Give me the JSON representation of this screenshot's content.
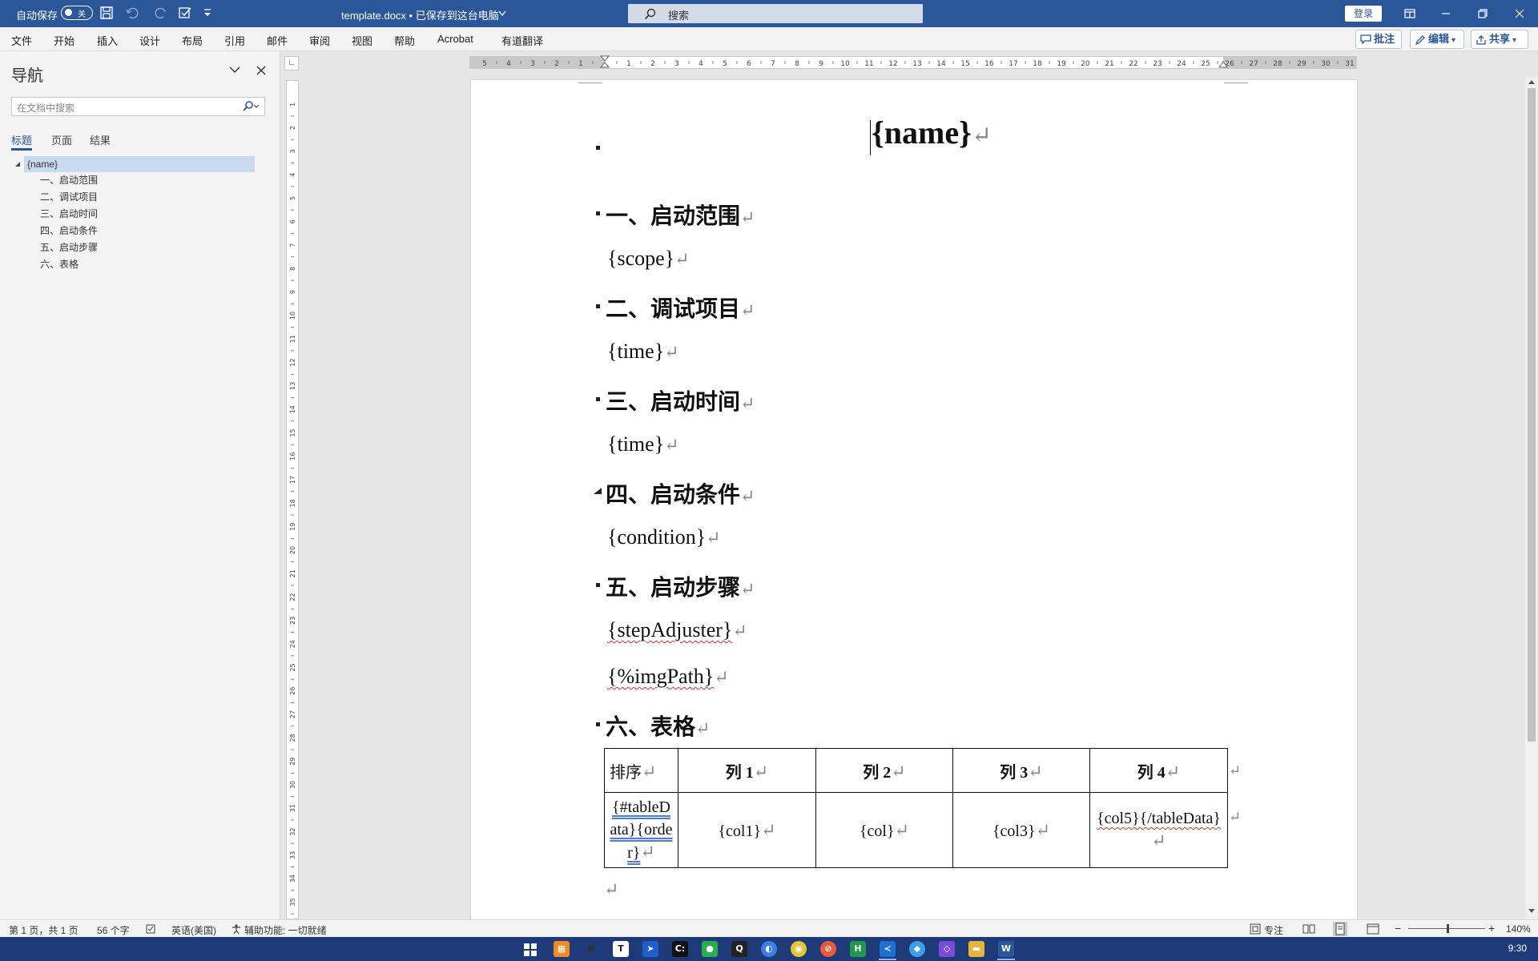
{
  "titlebar": {
    "autosave_label": "自动保存",
    "autosave_state": "关",
    "doc_title": "template.docx • 已保存到这台电脑",
    "search_label": "搜索",
    "login_label": "登录"
  },
  "ribbon": {
    "tabs": [
      "文件",
      "开始",
      "插入",
      "设计",
      "布局",
      "引用",
      "邮件",
      "审阅",
      "视图",
      "帮助",
      "Acrobat",
      "有道翻译"
    ],
    "comments_label": "批注",
    "edit_label": "编辑",
    "share_label": "共享"
  },
  "nav": {
    "title": "导航",
    "search_placeholder": "在文档中搜索",
    "tabs": [
      "标题",
      "页面",
      "结果"
    ],
    "headings": [
      "{name}",
      "一、启动范围",
      "二、调试项目",
      "三、启动时间",
      "四、启动条件",
      "五、启动步骤",
      "六、表格"
    ]
  },
  "document": {
    "title": "{name}",
    "sections": [
      {
        "heading": "一、启动范围",
        "content": "{scope}"
      },
      {
        "heading": "二、调试项目",
        "content": "{time}"
      },
      {
        "heading": "三、启动时间",
        "content": "{time}"
      },
      {
        "heading": "四、启动条件",
        "content": "{condition}"
      },
      {
        "heading": "五、启动步骤",
        "content": "{stepAdjuster}",
        "content2": "{%imgPath}"
      },
      {
        "heading": "六、表格"
      }
    ],
    "table": {
      "headers": [
        "排序",
        "列 1",
        "列 2",
        "列 3",
        "列 4"
      ],
      "row": [
        "{#tableData}{order}",
        "{col1}",
        "{col}",
        "{col3}",
        "{col5}{/tableData}"
      ]
    },
    "paragraph_mark": "↵"
  },
  "status": {
    "page": "第 1 页，共 1 页",
    "words": "56 个字",
    "language": "英语(美国)",
    "accessibility": "辅助功能: 一切就绪",
    "focus": "专注",
    "zoom": "140%"
  },
  "taskbar": {
    "clock": "9:30"
  }
}
